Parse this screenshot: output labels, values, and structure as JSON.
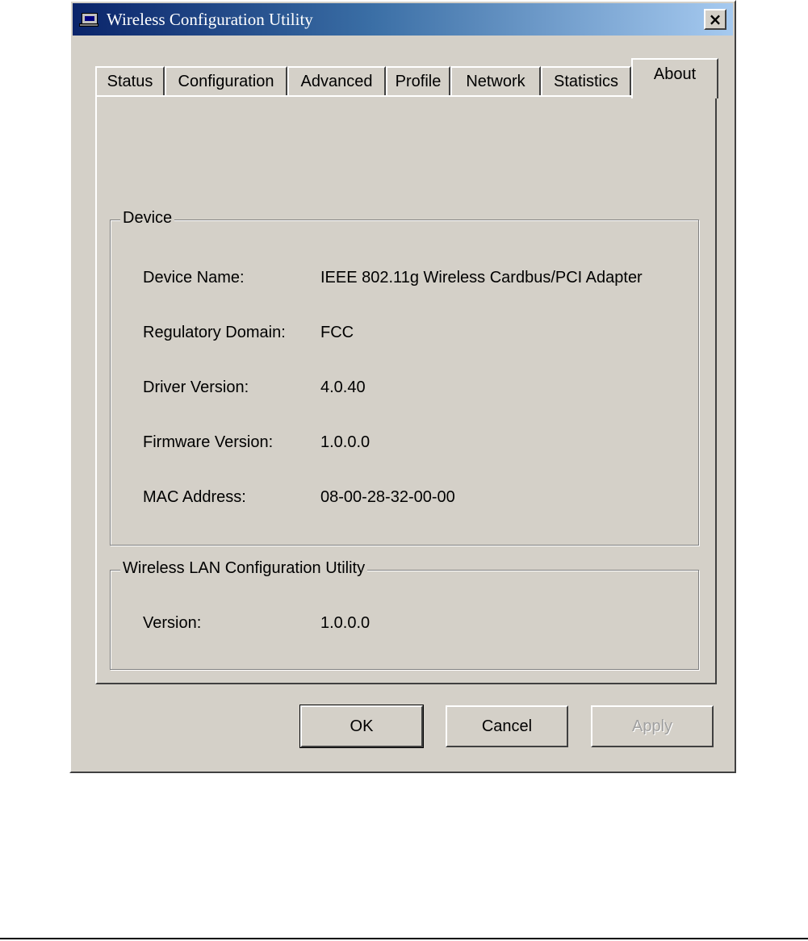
{
  "window": {
    "title": "Wireless Configuration Utility",
    "close_label": "×"
  },
  "tabs": [
    {
      "label": "Status"
    },
    {
      "label": "Configuration"
    },
    {
      "label": "Advanced"
    },
    {
      "label": "Profile"
    },
    {
      "label": "Network"
    },
    {
      "label": "Statistics"
    },
    {
      "label": "About",
      "active": true
    }
  ],
  "device": {
    "legend": "Device",
    "rows": [
      {
        "label": "Device Name:",
        "value": "IEEE 802.11g Wireless Cardbus/PCI Adapter"
      },
      {
        "label": "Regulatory Domain:",
        "value": "FCC"
      },
      {
        "label": "Driver Version:",
        "value": "4.0.40"
      },
      {
        "label": "Firmware Version:",
        "value": "1.0.0.0"
      },
      {
        "label": "MAC Address:",
        "value": "08-00-28-32-00-00"
      }
    ]
  },
  "utility": {
    "legend": "Wireless LAN Configuration Utility",
    "rows": [
      {
        "label": "Version:",
        "value": "1.0.0.0"
      }
    ]
  },
  "buttons": {
    "ok": "OK",
    "cancel": "Cancel",
    "apply": "Apply"
  }
}
